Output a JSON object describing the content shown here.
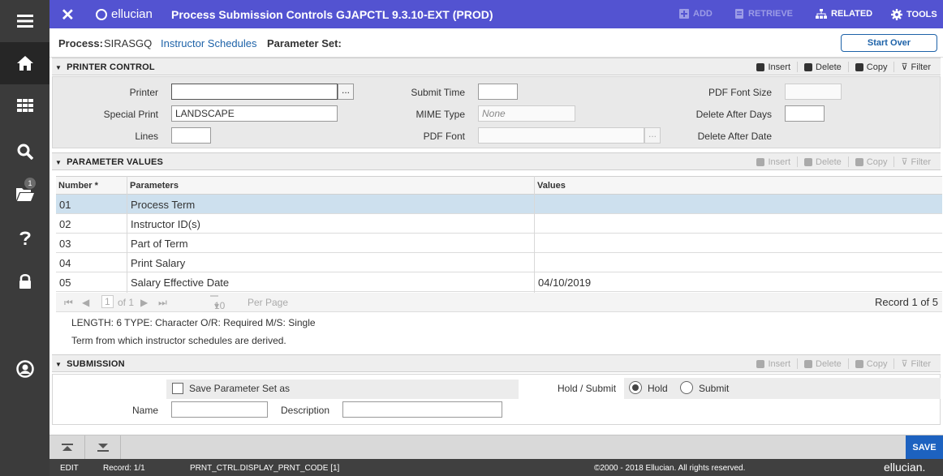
{
  "colors": {
    "header": "#5353d1",
    "sidebar": "#3b3b3b",
    "accent": "#1d62c0",
    "selected_row": "#cde0ee"
  },
  "sidebar": {
    "items": [
      {
        "icon": "menu-icon"
      },
      {
        "icon": "home-icon"
      },
      {
        "icon": "apps-grid-icon"
      },
      {
        "icon": "search-icon"
      },
      {
        "icon": "folder-icon",
        "badge": "1"
      },
      {
        "icon": "help-icon"
      },
      {
        "icon": "lock-icon"
      },
      {
        "icon": "user-profile-icon"
      }
    ]
  },
  "header": {
    "brand": "ellucian",
    "title": "Process Submission Controls GJAPCTL 9.3.10-EXT (PROD)",
    "actions": {
      "add": "ADD",
      "retrieve": "RETRIEVE",
      "related": "RELATED",
      "tools": "TOOLS"
    }
  },
  "process": {
    "process_label": "Process:",
    "process_code": "SIRASGQ",
    "process_name": "Instructor Schedules",
    "param_set_label": "Parameter Set:",
    "start_over": "Start Over"
  },
  "section_tools": {
    "insert": "Insert",
    "delete": "Delete",
    "copy": "Copy",
    "filter": "Filter"
  },
  "printer_control": {
    "title": "PRINTER CONTROL",
    "printer_label": "Printer",
    "printer_value": "",
    "special_print_label": "Special Print",
    "special_print_value": "LANDSCAPE",
    "lines_label": "Lines",
    "lines_value": "",
    "submit_time_label": "Submit Time",
    "submit_time_value": "",
    "mime_type_label": "MIME Type",
    "mime_type_value": "None",
    "pdf_font_label": "PDF Font",
    "pdf_font_value": "",
    "pdf_font_size_label": "PDF Font Size",
    "pdf_font_size_value": "",
    "delete_after_days_label": "Delete After Days",
    "delete_after_days_value": "",
    "delete_after_date_label": "Delete After Date",
    "browse_label": "..."
  },
  "parameter_values": {
    "title": "PARAMETER VALUES",
    "columns": {
      "number": "Number *",
      "parameters": "Parameters",
      "values": "Values"
    },
    "rows": [
      {
        "number": "01",
        "parameter": "Process Term",
        "value": ""
      },
      {
        "number": "02",
        "parameter": "Instructor ID(s)",
        "value": ""
      },
      {
        "number": "03",
        "parameter": "Part of Term",
        "value": ""
      },
      {
        "number": "04",
        "parameter": "Print Salary",
        "value": ""
      },
      {
        "number": "05",
        "parameter": "Salary Effective Date",
        "value": "04/10/2019"
      }
    ],
    "pager": {
      "page": "1",
      "of": "of 1",
      "per_page_value": "10",
      "per_page_label": "Per Page",
      "record": "Record 1 of 5"
    },
    "hint_line1": "LENGTH: 6 TYPE: Character O/R: Required M/S: Single",
    "hint_line2": "Term from which instructor schedules are derived."
  },
  "submission": {
    "title": "SUBMISSION",
    "save_param_set_label": "Save Parameter Set as",
    "name_label": "Name",
    "name_value": "",
    "description_label": "Description",
    "description_value": "",
    "hold_submit_label": "Hold / Submit",
    "hold_label": "Hold",
    "submit_label": "Submit",
    "selected": "Hold"
  },
  "footer": {
    "save": "SAVE",
    "mode": "EDIT",
    "record": "Record: 1/1",
    "field": "PRNT_CTRL.DISPLAY_PRNT_CODE [1]",
    "copyright": "©2000 - 2018 Ellucian. All rights reserved.",
    "brand": "ellucian."
  }
}
